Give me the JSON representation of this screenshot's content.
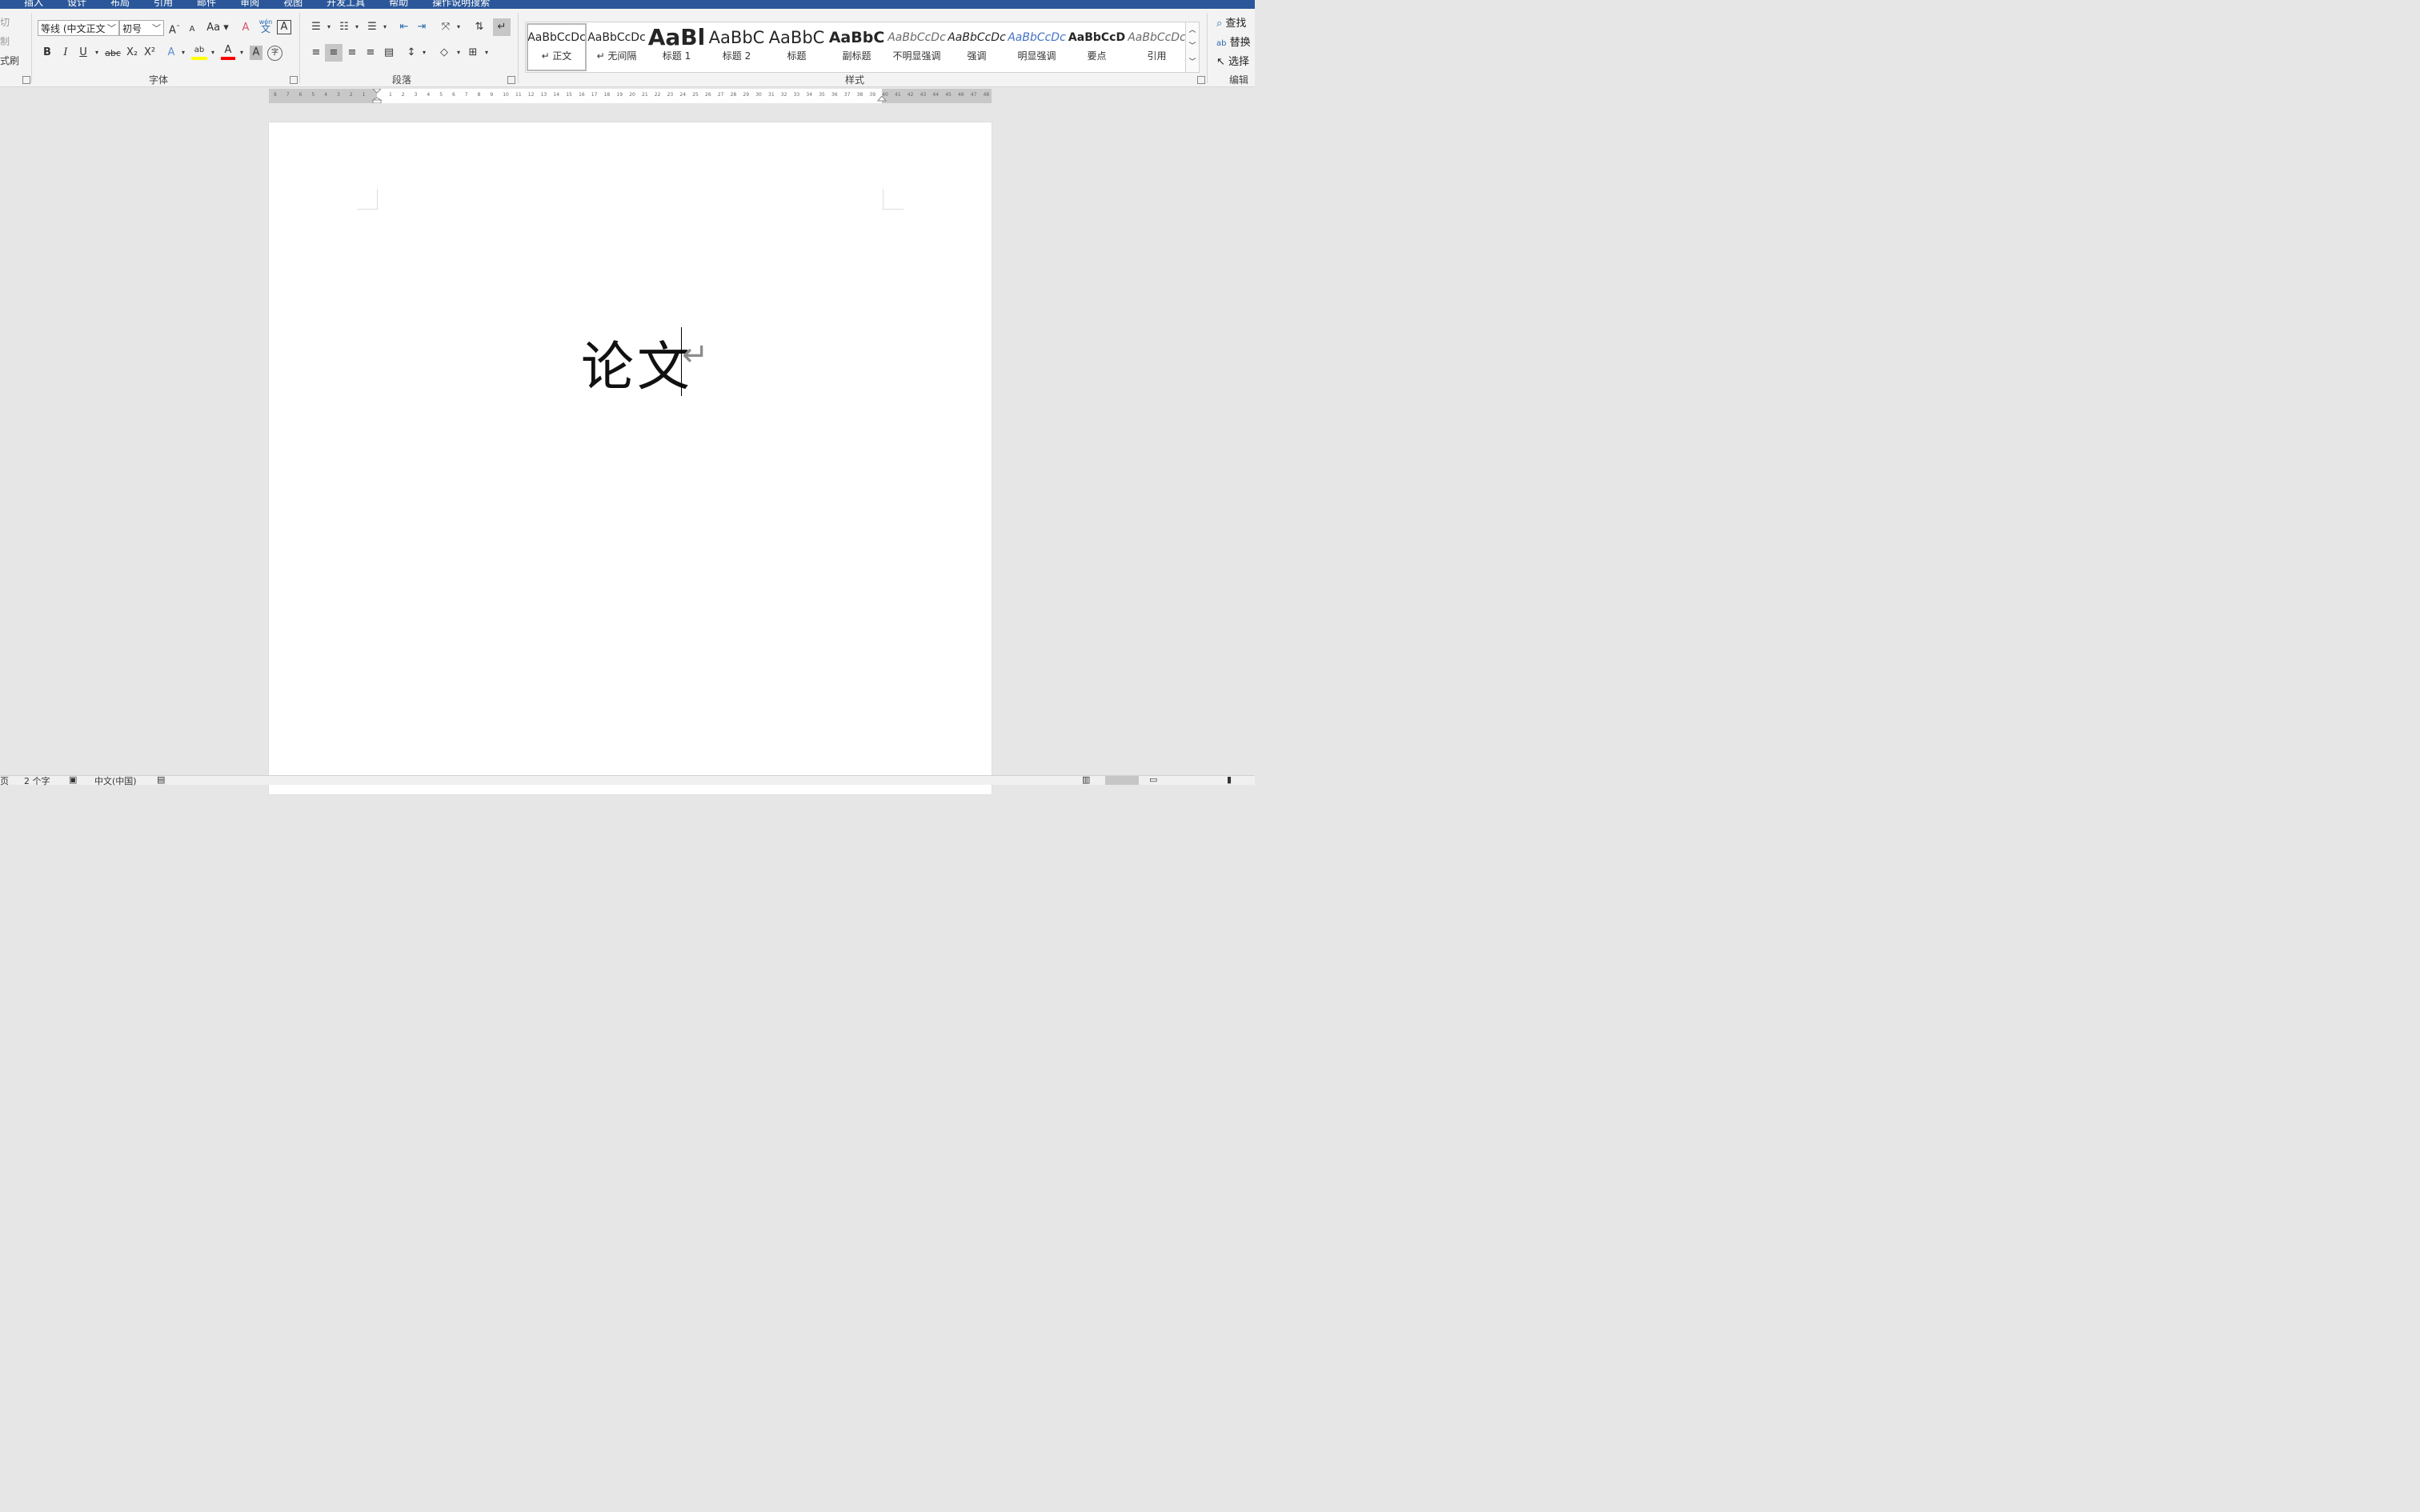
{
  "menu": {
    "tabs": [
      "插入",
      "设计",
      "布局",
      "引用",
      "邮件",
      "审阅",
      "视图",
      "开发工具",
      "帮助",
      "操作说明搜索"
    ]
  },
  "clipboard": {
    "cut": "切",
    "copy": "制",
    "format_painter": "式刷"
  },
  "font": {
    "group_label": "字体",
    "font_name": "等线 (中文正文",
    "font_size": "初号",
    "change_case": "Aa",
    "phonetic_top": "wén",
    "phonetic_bottom": "文",
    "bold": "B",
    "italic": "I",
    "underline": "U",
    "strikethrough": "abc",
    "subscript": "X₂",
    "superscript": "X²",
    "highlight_icon": "ab",
    "font_color_icon": "A",
    "char_shading": "A",
    "enclose_char": "字"
  },
  "paragraph": {
    "group_label": "段落"
  },
  "styles": {
    "group_label": "样式",
    "items": [
      {
        "sample": "AaBbCcDc",
        "label": "↵ 正文"
      },
      {
        "sample": "AaBbCcDc",
        "label": "↵ 无间隔"
      },
      {
        "sample": "AaBl",
        "label": "标题 1"
      },
      {
        "sample": "AaBbC",
        "label": "标题 2"
      },
      {
        "sample": "AaBbC",
        "label": "标题"
      },
      {
        "sample": "AaBbC",
        "label": "副标题"
      },
      {
        "sample": "AaBbCcDc",
        "label": "不明显强调"
      },
      {
        "sample": "AaBbCcDc",
        "label": "强调"
      },
      {
        "sample": "AaBbCcDc",
        "label": "明显强调"
      },
      {
        "sample": "AaBbCcD",
        "label": "要点"
      },
      {
        "sample": "AaBbCcDc",
        "label": "引用"
      }
    ]
  },
  "editing": {
    "group_label": "编辑",
    "find": "查找",
    "replace": "替换",
    "select": "选择"
  },
  "ruler": {
    "left_ticks": [
      "8",
      "7",
      "6",
      "5",
      "4",
      "3",
      "2",
      "1"
    ],
    "right_ticks": [
      "1",
      "2",
      "3",
      "4",
      "5",
      "6",
      "7",
      "8",
      "9",
      "10",
      "11",
      "12",
      "13",
      "14",
      "15",
      "16",
      "17",
      "18",
      "19",
      "20",
      "21",
      "22",
      "23",
      "24",
      "25",
      "26",
      "27",
      "28",
      "29",
      "30",
      "31",
      "32",
      "33",
      "34",
      "35",
      "36",
      "37",
      "38",
      "39",
      "40",
      "41",
      "42",
      "43",
      "44",
      "45",
      "46",
      "47",
      "48"
    ]
  },
  "document": {
    "title": "论文",
    "paragraph_mark": "↵"
  },
  "status": {
    "page": "页",
    "word_count": "2 个字",
    "language": "中文(中国)"
  },
  "colors": {
    "accent": "#2b579a",
    "highlight": "#ffff00",
    "font_color": "#ff0000"
  }
}
